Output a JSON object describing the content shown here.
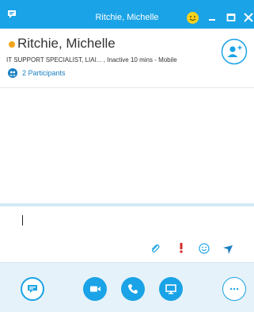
{
  "window": {
    "title": "Ritchie, Michelle",
    "app_icon": "skype-chat-icon",
    "controls": [
      "emoji-icon",
      "minimize-icon",
      "maximize-icon",
      "close-icon"
    ]
  },
  "contact": {
    "name": "Ritchie, Michelle",
    "status_line": "IT SUPPORT SPECIALIST, LIAI... , Inactive 10 mins - Mobile",
    "presence": "away",
    "presence_color": "#f2a51a",
    "participants_label": "2 Participants"
  },
  "compose": {
    "tools": [
      "paperclip-icon",
      "exclamation-icon",
      "smiley-icon",
      "send-icon"
    ]
  },
  "bottom_bar": {
    "buttons": [
      "im-icon",
      "video-icon",
      "phone-icon",
      "present-screen-icon",
      "more-options-icon"
    ]
  },
  "colors": {
    "accent": "#1aa3e6",
    "priority": "#d62b2b",
    "link": "#1a7fc1"
  }
}
